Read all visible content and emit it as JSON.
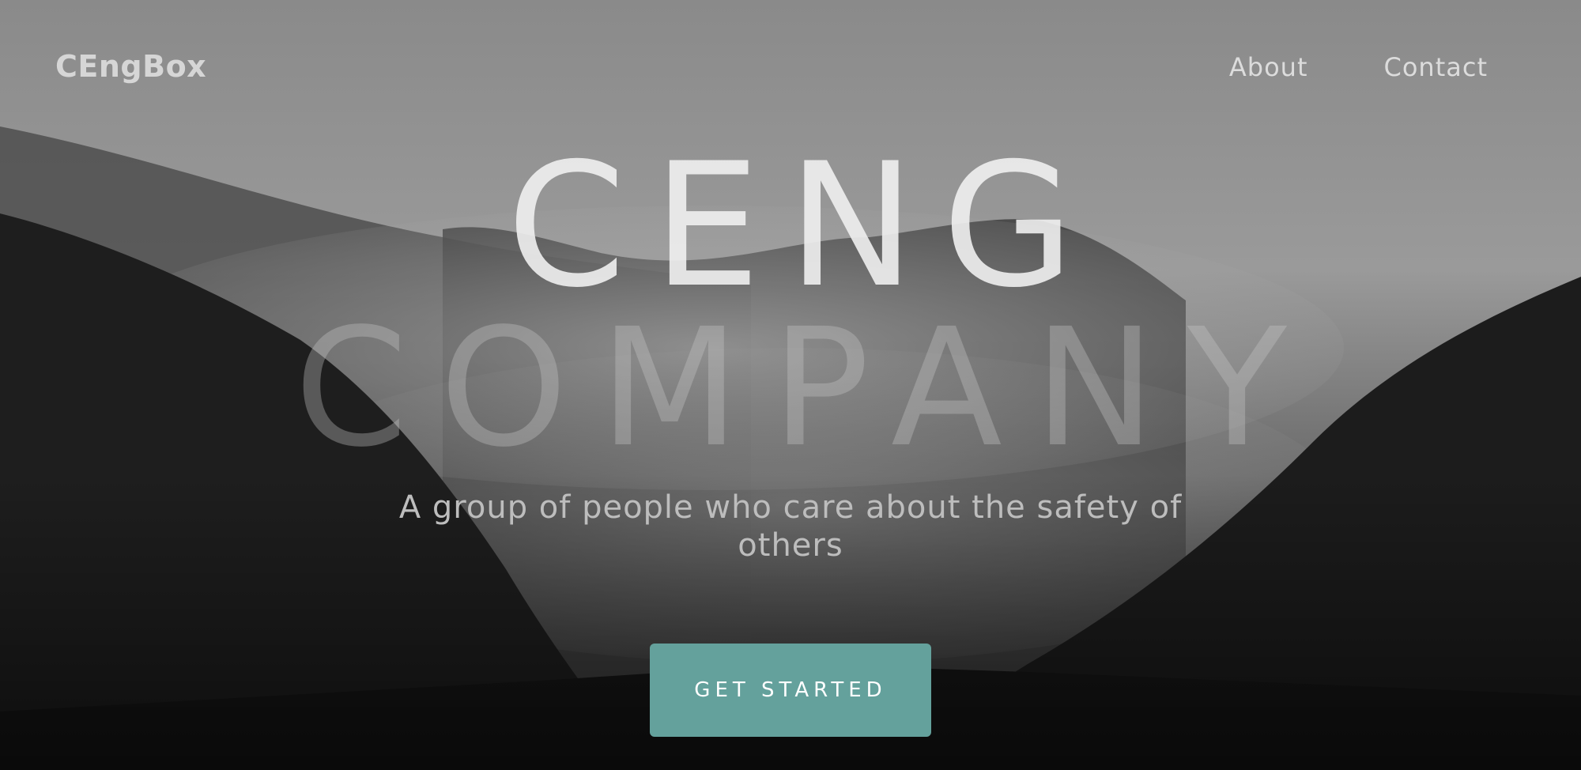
{
  "navbar": {
    "brand": "CEngBox",
    "links": [
      "About",
      "Contact"
    ]
  },
  "hero": {
    "headline_line1": "CENG",
    "headline_line2": "COMPANY",
    "tagline": "A group of people who care about the safety of others",
    "cta_label": "GET STARTED"
  },
  "colors": {
    "accent": "#64a19c",
    "text_light": "#d6d6d6",
    "background": "#1a1a1a"
  }
}
